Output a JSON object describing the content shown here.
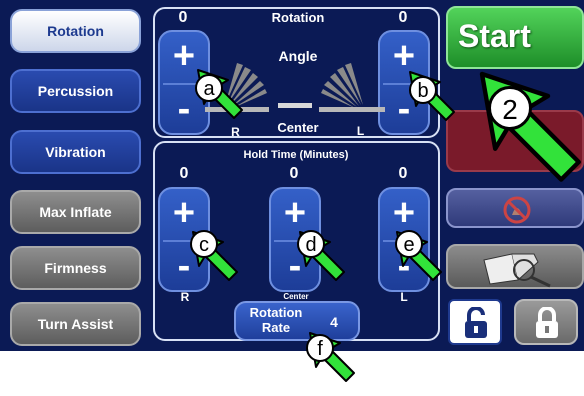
{
  "menu": {
    "rotation": "Rotation",
    "percussion": "Percussion",
    "vibration": "Vibration",
    "max_inflate": "Max Inflate",
    "firmness": "Firmness",
    "turn_assist": "Turn Assist"
  },
  "rotation_panel": {
    "title": "Rotation",
    "angle_label": "Angle",
    "center_label": "Center",
    "left_value": "0",
    "right_value": "0",
    "r_label": "R",
    "l_label": "L",
    "plus": "+",
    "minus": "-"
  },
  "hold_panel": {
    "title": "Hold Time (Minutes)",
    "r_value": "0",
    "center_value": "0",
    "l_value": "0",
    "r_label": "R",
    "center_label": "Center",
    "l_label": "L",
    "plus": "+",
    "minus": "-"
  },
  "rotation_rate": {
    "label_line1": "Rotation",
    "label_line2": "Rate",
    "value": "4"
  },
  "start_label": "Start",
  "annotations": {
    "a": "a",
    "b": "b",
    "c": "c",
    "d": "d",
    "e": "e",
    "f": "f",
    "step2": "2"
  },
  "colors": {
    "background": "#0b1a55",
    "start_green": "#2fb53a",
    "arrow_green": "#32e23a",
    "stop_red": "#7a1a2a"
  }
}
